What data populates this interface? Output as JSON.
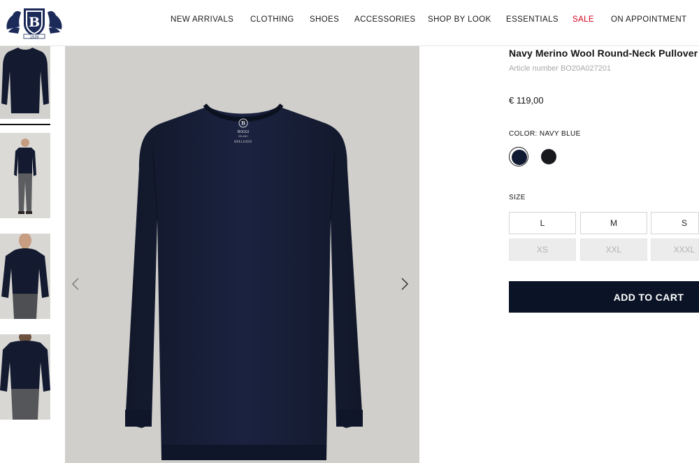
{
  "brand": {
    "logo_letter": "B",
    "logo_year": "1939",
    "tag_brand": "BOGGI",
    "tag_sub": "MILANO",
    "tag_line": "BRELAXED"
  },
  "nav": {
    "items": [
      {
        "label": "NEW ARRIVALS"
      },
      {
        "label": "CLOTHING"
      },
      {
        "label": "SHOES"
      },
      {
        "label": "ACCESSORIES"
      },
      {
        "label": "SHOP BY LOOK"
      },
      {
        "label": "ESSENTIALS"
      },
      {
        "label": "SALE"
      },
      {
        "label": "ON APPOINTMENT"
      }
    ]
  },
  "product": {
    "title": "Navy Merino Wool Round-Neck Pullover",
    "article": "Article number BO20A027201",
    "price": "€ 119,00",
    "color_label": "COLOR: NAVY BLUE",
    "colors": [
      {
        "hex": "#111a33",
        "selected": true
      },
      {
        "hex": "#17191d",
        "selected": false
      }
    ],
    "size_label": "SIZE",
    "sizes": [
      {
        "label": "L",
        "available": true
      },
      {
        "label": "M",
        "available": true
      },
      {
        "label": "S",
        "available": true
      },
      {
        "label": "XS",
        "available": false
      },
      {
        "label": "XXL",
        "available": false
      },
      {
        "label": "XXXL",
        "available": false
      }
    ],
    "add_to_cart": "ADD TO CART"
  },
  "colors": {
    "accent_sale": "#d0021b",
    "sweater_navy": "#141b30",
    "button_dark": "#0b1426",
    "image_bg": "#d0cfcc"
  }
}
